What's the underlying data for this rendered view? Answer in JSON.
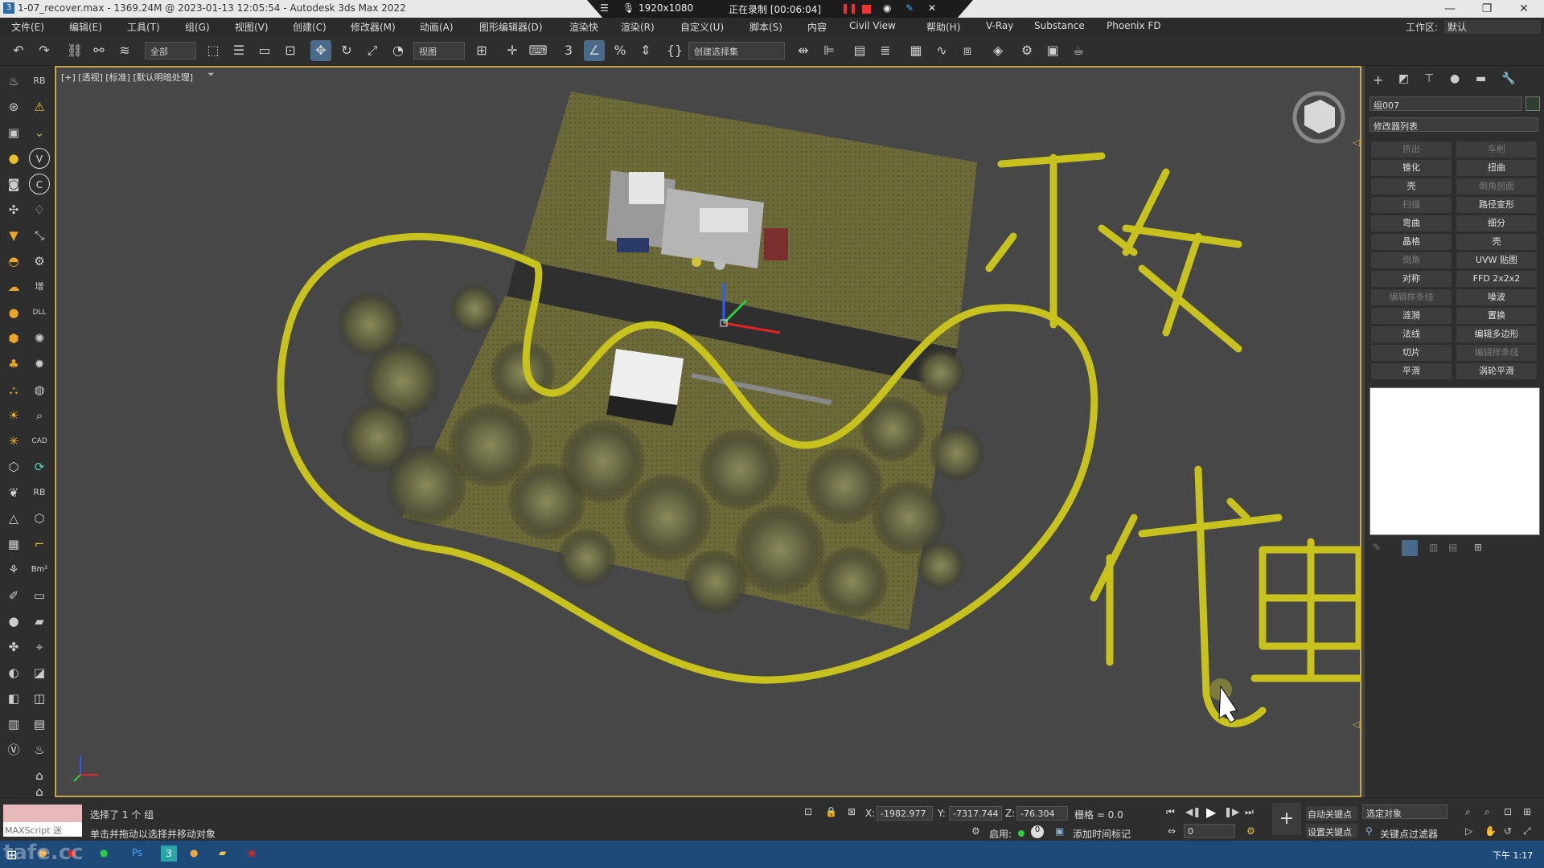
{
  "window": {
    "title": "1-07_recover.max - 1369.24M @ 2023-01-13 12:05:54 - Autodesk 3ds Max 2022",
    "recording": {
      "resolution": "1920x1080",
      "status": "正在录制 [00:06:04]"
    },
    "minimize": "—",
    "restore": "❐",
    "close": "✕"
  },
  "menu": [
    "文件(E)",
    "编辑(E)",
    "工具(T)",
    "组(G)",
    "视图(V)",
    "创建(C)",
    "修改器(M)",
    "动画(A)",
    "图形编辑器(D)",
    "渲染快",
    "渲染(R)",
    "自定义(U)",
    "脚本(S)",
    "内容",
    "Civil View",
    "帮助(H)",
    "V-Ray",
    "Substance",
    "Phoenix FD"
  ],
  "workspace": {
    "label": "工作区:",
    "value": "默认"
  },
  "toolbar": {
    "selection_filter": "全部",
    "ref_coord": "视图",
    "named_sel": "创建选择集"
  },
  "viewport": {
    "label": "[+] [透视] [标准] [默认明暗处理]",
    "handwriting": [
      "不友",
      "代理"
    ],
    "ink_color": "#c8c21e"
  },
  "command_panel": {
    "object_name": "组007",
    "modifier_list": "修改器列表",
    "modifiers": [
      [
        "挤出",
        "车削"
      ],
      [
        "锥化",
        "扭曲"
      ],
      [
        "壳",
        "倒角剖面"
      ],
      [
        "扫描",
        "路径变形"
      ],
      [
        "弯曲",
        "细分"
      ],
      [
        "晶格",
        "壳"
      ],
      [
        "倒角",
        "UVW 贴图"
      ],
      [
        "对称",
        "FFD 2x2x2"
      ],
      [
        "编辑样条线",
        "噪波"
      ],
      [
        "涟漪",
        "置换"
      ],
      [
        "法线",
        "编辑多边形"
      ],
      [
        "切片",
        "编辑样条线"
      ],
      [
        "平滑",
        "涡轮平滑"
      ]
    ],
    "disabled": [
      "挤出",
      "车削",
      "倒角剖面",
      "扫描",
      "倒角",
      "编辑样条线"
    ]
  },
  "status": {
    "maxscript": "MAXScript 迷",
    "selected": "选择了 1 个 组",
    "prompt": "单击并拖动以选择并移动对象",
    "x_label": "X:",
    "x": "-1982.977",
    "y_label": "Y:",
    "y": "-7317.744",
    "z_label": "Z:",
    "z": "-76.304",
    "grid": "栅格 = 0.0",
    "enable": "启用:",
    "add_time_tag": "添加时间标记",
    "auto_key": "自动关键点",
    "set_key": "设置关键点",
    "sel_obj": "选定对象",
    "key_filter": "关键点过滤器",
    "frame": "0"
  },
  "taskbar": {
    "time": "下午 1:17"
  },
  "watermark": "tafe.cc"
}
